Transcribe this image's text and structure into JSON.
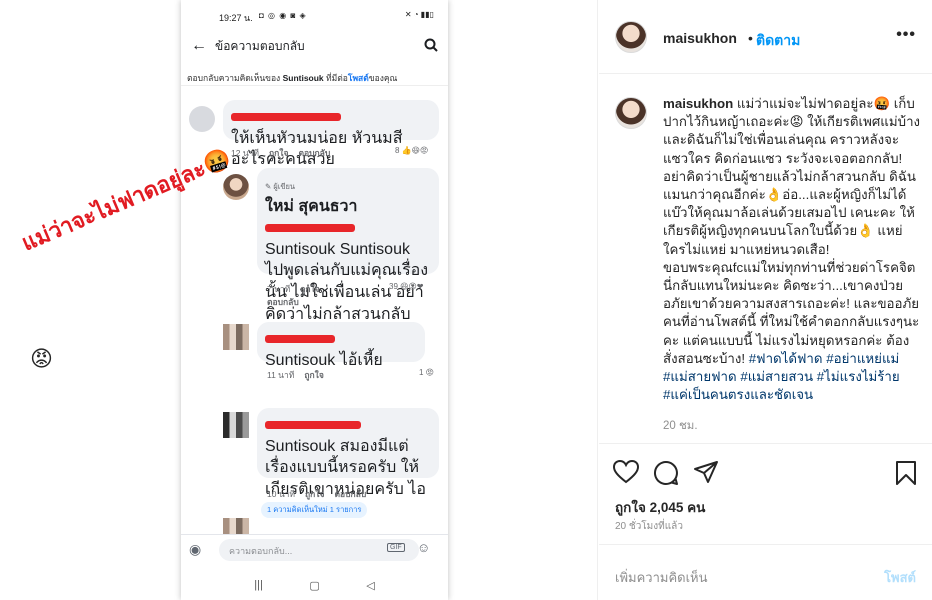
{
  "phone": {
    "status_time": "19:27 น.",
    "status_icons_left": "◘ ◎ ◉ ◙ ◈",
    "status_icons_right": "✕ ◔ ▮▮▯",
    "title": "ข้อความตอบกลับ",
    "subhead_prefix": "ตอบกลับความคิดเห็นของ",
    "subhead_name": "Suntisouk",
    "subhead_mid": "ที่มีต่อ",
    "subhead_link": "โพสต์",
    "subhead_suffix": "ของคุณ",
    "comments": [
      {
        "text": "ให้เห็นหัวนมน่อย หัวนมสีอะไรคะคนสวย",
        "time": "12 นาที",
        "like": "ถูกใจ",
        "reply": "ตอบกลับ",
        "count": "8"
      },
      {
        "badge": "ผู้เขียน",
        "author": "ใหม่ สุคนธวา",
        "text": "Suntisouk Suntisouk ไปพูดเล่นกับแม่คุณเรื่องนั้น ไม่ใช่เพื่อนเล่น อย่าคิดว่าไม่กล้าสวนกลับผู้ชายนะ ฟลาย! สมองหมา",
        "time": "7 นาที",
        "like": "ถูกใจ",
        "reply": "ตอบกลับ",
        "count": "39"
      },
      {
        "text": "Suntisouk ไอ้เหี้ย",
        "time": "11 นาที",
        "like": "ถูกใจ",
        "count": "1"
      },
      {
        "text": "Suntisouk สมองมีแต่เรื่องแบบนี้หรอครับ ให้เกียรติเขาหน่อยครับ ไอควาย",
        "time": "10 นาที",
        "like": "ถูกใจ",
        "reply": "ตอบกลับ"
      }
    ],
    "new_comments": "1 ความคิดเห็นใหม่ 1 รายการ",
    "composer_placeholder": "ความตอบกลับ...",
    "gif": "GIF"
  },
  "overlay_text": "แม่ว่าจะไม่ฟาดอยู่ละ🤬",
  "overlay_emoji": "😡",
  "panel": {
    "username": "maisukhon",
    "dot": "•",
    "follow": "ติดตาม",
    "more": "•••",
    "caption_user": "maisukhon",
    "caption_text": "แม่ว่าแม่จะไม่ฟาดอยู่ละ🤬 เก็บปากไว้กินหญ้าเถอะค่ะ😡 ให้เกียรติเพศแม่บ้าง และดิฉันก็ไม่ใช่เพื่อนเล่นคุณ คราวหลังจะแซวใคร คิดก่อนแซว ระวังจะเจอตอกกลับ! อย่าคิดว่าเป็นผู้ชายแล้วไม่กล้าสวนกลับ ดิฉันแมนกว่าคุณอีกค่ะ👌อ่อ...และผู้หญิงก็ไม่ได้แบ๊วให้คุณมาล้อเล่นด้วยเสมอไป เคนะคะ ให้เกียรติผู้หญิงทุกคนบนโลกใบนี้ด้วย👌 แหย่ใครไม่แหย่ มาแหย่หนวดเสือ! ขอบพระคุณfcแม่ใหม่ทุกท่านที่ช่วยด่าโรคจิตนี่กลับแทนใหม่นะคะ คิดซะว่า...เขาคงป่วย อภัยเขาด้วยความสงสารเถอะค่ะ! และขออภัยคนที่อ่านโพสต์นี้ ที่ใหม่ใช้คำตอกกลับแรงๆนะคะ แต่คนแบบนี้ ไม่แรงไม่หยุดหรอกค่ะ ต้องสั่งสอนซะบ้าง!",
    "hashtags": "#ฟาดได้ฟาด #อย่าแหย่แม่ #แม่สายฟาด #แม่สายสวน #ไม่แรงไม่ร้าย #แค่เป็นคนตรงและชัดเจน",
    "caption_time": "20 ชม.",
    "likes": "ถูกใจ 2,045 คน",
    "posted": "20 ชั่วโมงที่แล้ว",
    "add_comment": "เพิ่มความคิดเห็น",
    "post": "โพสต์"
  },
  "colors": {
    "accent": "#0095f6",
    "hashtag": "#00376b",
    "overlay": "#e11b22",
    "post_disabled": "#b2dffc"
  }
}
